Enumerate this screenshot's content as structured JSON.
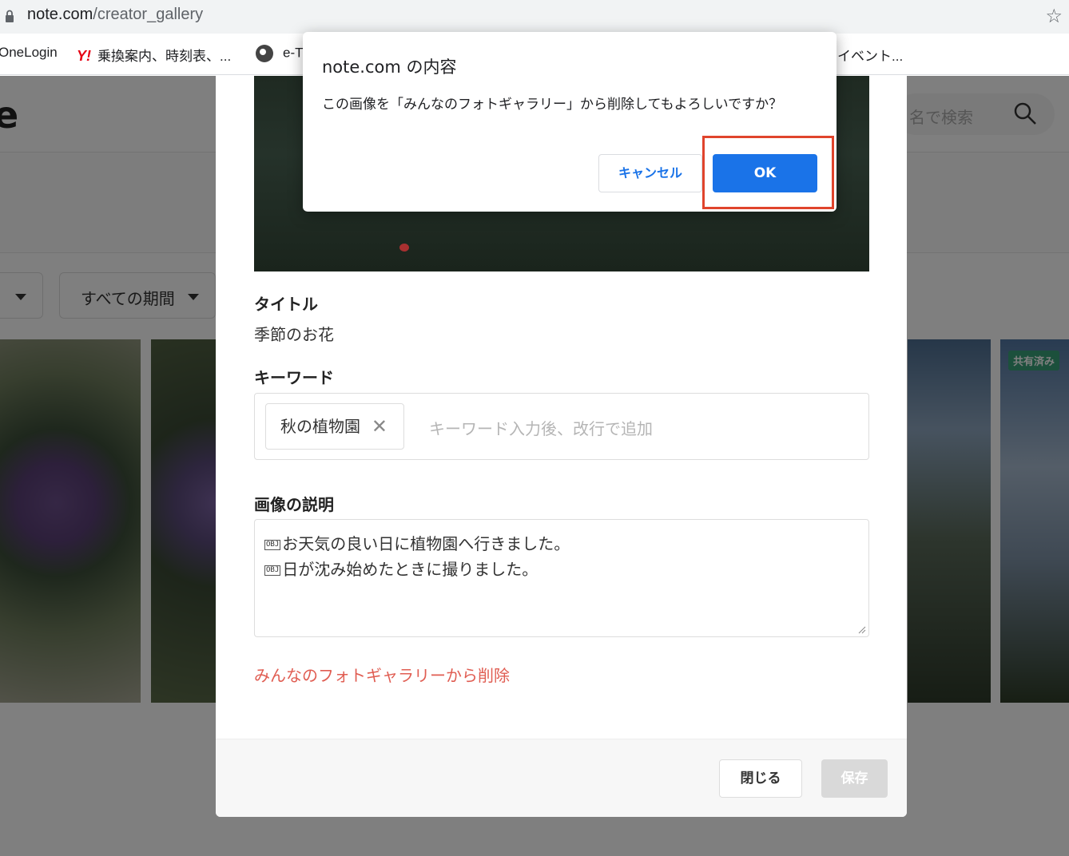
{
  "browser": {
    "url_host": "note.com",
    "url_path": "/creator_gallery",
    "bookmarks": [
      "OneLogin",
      "乗換案内、時刻表、...",
      "e-T",
      "イベント..."
    ]
  },
  "page": {
    "logo_fragment": "e",
    "search_placeholder": "名で検索",
    "filters": [
      "",
      "すべての期間"
    ],
    "shared_badge": "共有済み"
  },
  "modal": {
    "title_label": "タイトル",
    "title_value": "季節のお花",
    "keyword_label": "キーワード",
    "keywords": [
      "秋の植物園"
    ],
    "keyword_placeholder": "キーワード入力後、改行で追加",
    "description_label": "画像の説明",
    "description_lines": [
      "お天気の良い日に植物園へ行きました。",
      "日が沈み始めたときに撮りました。"
    ],
    "delete_link": "みんなのフォトギャラリーから削除",
    "close_button": "閉じる",
    "save_button": "保存"
  },
  "alert": {
    "title": "note.com の内容",
    "message": "この画像を「みんなのフォトギャラリー」から削除してもよろしいですか？",
    "cancel_button": "キャンセル",
    "ok_button": "OK"
  },
  "colors": {
    "accent_blue": "#1a73e8",
    "delete_red": "#e05d52",
    "highlight_red": "#e0442c",
    "shared_green": "#39a078"
  }
}
